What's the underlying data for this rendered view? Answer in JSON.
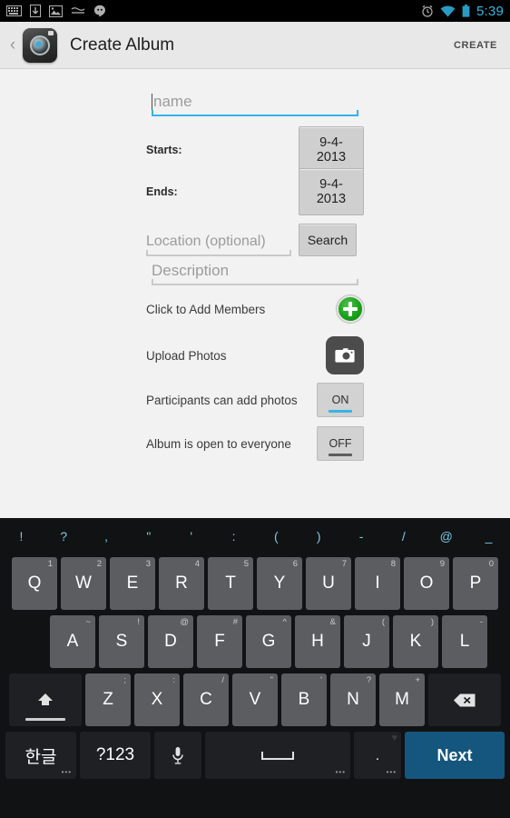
{
  "status_bar": {
    "icons": [
      "keyboard-icon",
      "download-icon",
      "image-icon",
      "sleep-icon",
      "hangouts-icon"
    ],
    "alarm_icon": "alarm-icon",
    "wifi_icon": "wifi-icon",
    "battery_icon": "battery-icon",
    "clock": "5:39",
    "accent_color": "#33b5e5"
  },
  "action_bar": {
    "back_icon": "back-chevron-icon",
    "app_icon": "camera-app-icon",
    "title": "Create Album",
    "action_label": "CREATE"
  },
  "form": {
    "name": {
      "placeholder": "name",
      "value": "",
      "focused": true
    },
    "starts": {
      "label": "Starts:",
      "value": "9-4-2013"
    },
    "ends": {
      "label": "Ends:",
      "value": "9-4-2013"
    },
    "location": {
      "placeholder": "Location (optional)",
      "value": "",
      "search_label": "Search"
    },
    "description": {
      "placeholder": "Description",
      "value": ""
    },
    "members": {
      "label": "Click to Add Members",
      "icon": "add-plus-icon"
    },
    "upload": {
      "label": "Upload Photos",
      "icon": "camera-icon"
    },
    "participants_toggle": {
      "label": "Participants can add photos",
      "value": "ON",
      "state": "on"
    },
    "open_toggle": {
      "label": "Album is open to everyone",
      "value": "OFF",
      "state": "off"
    }
  },
  "keyboard": {
    "symbols": [
      "!",
      "?",
      ",",
      "\"",
      "'",
      ":",
      "(",
      ")",
      "-",
      "/",
      "@",
      "_"
    ],
    "row1": [
      {
        "key": "Q",
        "hint": "1"
      },
      {
        "key": "W",
        "hint": "2"
      },
      {
        "key": "E",
        "hint": "3"
      },
      {
        "key": "R",
        "hint": "4"
      },
      {
        "key": "T",
        "hint": "5"
      },
      {
        "key": "Y",
        "hint": "6"
      },
      {
        "key": "U",
        "hint": "7"
      },
      {
        "key": "I",
        "hint": "8"
      },
      {
        "key": "O",
        "hint": "9"
      },
      {
        "key": "P",
        "hint": "0"
      }
    ],
    "row2": [
      {
        "key": "A",
        "hint": "~"
      },
      {
        "key": "S",
        "hint": "!"
      },
      {
        "key": "D",
        "hint": "@"
      },
      {
        "key": "F",
        "hint": "#"
      },
      {
        "key": "G",
        "hint": "^"
      },
      {
        "key": "H",
        "hint": "&"
      },
      {
        "key": "J",
        "hint": "("
      },
      {
        "key": "K",
        "hint": ")"
      },
      {
        "key": "L",
        "hint": "-"
      }
    ],
    "row3": [
      {
        "key": "Z",
        "hint": ";"
      },
      {
        "key": "X",
        "hint": ":"
      },
      {
        "key": "C",
        "hint": "/"
      },
      {
        "key": "V",
        "hint": "\""
      },
      {
        "key": "B",
        "hint": "'"
      },
      {
        "key": "N",
        "hint": "?"
      },
      {
        "key": "M",
        "hint": "+"
      }
    ],
    "shift_icon": "shift-up-arrow-icon",
    "backspace_icon": "backspace-icon",
    "lang_key": "한글",
    "num_key": "?123",
    "mic_icon": "microphone-icon",
    "space_icon": "space-bar-icon",
    "period_key": ".",
    "period_hint": "heart-icon",
    "enter_key": "Next",
    "enter_color": "#14567e"
  }
}
